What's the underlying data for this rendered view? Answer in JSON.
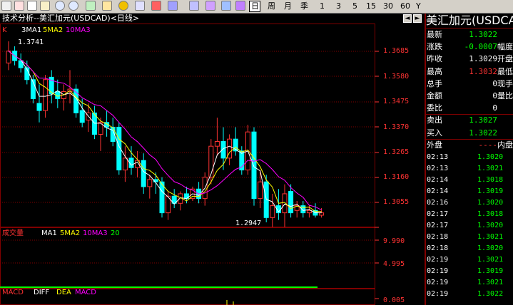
{
  "toolbar": {
    "icons": [
      "chart-icon",
      "chart-icon",
      "f10-icon",
      "zoom-in-icon",
      "zoom-out-icon",
      "refresh-icon",
      "grid-icon",
      "color-icon",
      "pin-icon",
      "box-icon",
      "book-icon"
    ],
    "periods": [
      "日",
      "周",
      "月",
      "季",
      "1",
      "3",
      "5",
      "15",
      "30",
      "60",
      "Y"
    ]
  },
  "header": {
    "title": "技术分析--美汇加元(USDCAD)<日线>",
    "nav_left": "◄",
    "nav_right": "►"
  },
  "main": {
    "legend": {
      "k": "K",
      "ma1": "3MA1",
      "ma2": "5MA2",
      "ma3": "10MA3"
    },
    "high_label": "1.3741",
    "low_label": "1.2947",
    "price_ticks": [
      "1.3685",
      "1.3580",
      "1.3475",
      "1.3370",
      "1.3265",
      "1.3160",
      "1.3055"
    ],
    "volume_legend": {
      "name": "成交量",
      "ma1": "MA1",
      "ma2": "5MA2",
      "ma3": "10MA3",
      "ma3_value": "20"
    },
    "volume_ticks": [
      "9.990",
      "4.995"
    ],
    "macd_legend": {
      "name": "MACD",
      "diff": "DIFF",
      "dea": "DEA",
      "macd": "MACD"
    },
    "macd_ticks": [
      "0.005"
    ]
  },
  "quote": {
    "title": "美汇加元(USDCAD)",
    "rows": [
      {
        "label": "最新",
        "value": "1.3022",
        "value_color": "#00ff00",
        "extra": ""
      },
      {
        "label": "涨跌",
        "value": "-0.0007",
        "value_color": "#00ff00",
        "extra": "幅度"
      },
      {
        "label": "昨收",
        "value": "1.3029",
        "value_color": "#ffffff",
        "extra": "开盘"
      },
      {
        "label": "最高",
        "value": "1.3032",
        "value_color": "#ff3333",
        "extra": "最低"
      },
      {
        "label": "总手",
        "value": "0",
        "value_color": "#ffffff",
        "extra": "现手"
      },
      {
        "label": "金额",
        "value": "0",
        "value_color": "#ffffff",
        "extra": "量比"
      },
      {
        "label": "委比",
        "value": "0",
        "value_color": "#ffffff",
        "extra": ""
      },
      {
        "label": "卖出",
        "value": "1.3027",
        "value_color": "#00ff00",
        "extra": ""
      },
      {
        "label": "买入",
        "value": "1.3022",
        "value_color": "#00ff00",
        "extra": ""
      },
      {
        "label": "外盘",
        "value": "----",
        "value_color": "#ff3333",
        "extra": "内盘"
      }
    ],
    "ticks": [
      {
        "time": "02:13",
        "price": "1.3020"
      },
      {
        "time": "02:13",
        "price": "1.3021"
      },
      {
        "time": "02:14",
        "price": "1.3018"
      },
      {
        "time": "02:14",
        "price": "1.3019"
      },
      {
        "time": "02:16",
        "price": "1.3020"
      },
      {
        "time": "02:17",
        "price": "1.3018"
      },
      {
        "time": "02:17",
        "price": "1.3020"
      },
      {
        "time": "02:18",
        "price": "1.3021"
      },
      {
        "time": "02:18",
        "price": "1.3020"
      },
      {
        "time": "02:19",
        "price": "1.3021"
      },
      {
        "time": "02:19",
        "price": "1.3019"
      },
      {
        "time": "02:19",
        "price": "1.3021"
      },
      {
        "time": "02:19",
        "price": "1.3022"
      }
    ]
  },
  "chart_data": {
    "type": "candlestick",
    "ylim": [
      1.2947,
      1.3741
    ],
    "up_color": "#ff3333",
    "down_color": "#00ffff",
    "candles": [
      [
        1.365,
        1.3741,
        1.362,
        1.37
      ],
      [
        1.37,
        1.372,
        1.364,
        1.366
      ],
      [
        1.366,
        1.369,
        1.361,
        1.363
      ],
      [
        1.363,
        1.366,
        1.356,
        1.358
      ],
      [
        1.358,
        1.36,
        1.348,
        1.35
      ],
      [
        1.348,
        1.356,
        1.34,
        1.345
      ],
      [
        1.345,
        1.36,
        1.342,
        1.358
      ],
      [
        1.359,
        1.362,
        1.348,
        1.352
      ],
      [
        1.353,
        1.358,
        1.346,
        1.35
      ],
      [
        1.35,
        1.356,
        1.345,
        1.353
      ],
      [
        1.353,
        1.362,
        1.348,
        1.354
      ],
      [
        1.354,
        1.356,
        1.342,
        1.344
      ],
      [
        1.345,
        1.35,
        1.338,
        1.34
      ],
      [
        1.341,
        1.348,
        1.336,
        1.344
      ],
      [
        1.344,
        1.347,
        1.333,
        1.335
      ],
      [
        1.335,
        1.342,
        1.328,
        1.34
      ],
      [
        1.34,
        1.345,
        1.334,
        1.338
      ],
      [
        1.338,
        1.342,
        1.33,
        1.332
      ],
      [
        1.338,
        1.34,
        1.318,
        1.32
      ],
      [
        1.32,
        1.33,
        1.315,
        1.325
      ],
      [
        1.325,
        1.33,
        1.318,
        1.321
      ],
      [
        1.321,
        1.328,
        1.317,
        1.324
      ],
      [
        1.324,
        1.327,
        1.31,
        1.313
      ],
      [
        1.313,
        1.318,
        1.308,
        1.316
      ],
      [
        1.316,
        1.319,
        1.31,
        1.315
      ],
      [
        1.315,
        1.317,
        1.3,
        1.302
      ],
      [
        1.302,
        1.311,
        1.299,
        1.309
      ],
      [
        1.309,
        1.312,
        1.304,
        1.306
      ],
      [
        1.306,
        1.311,
        1.303,
        1.31
      ],
      [
        1.31,
        1.313,
        1.306,
        1.308
      ],
      [
        1.308,
        1.313,
        1.307,
        1.312
      ],
      [
        1.312,
        1.315,
        1.306,
        1.308
      ],
      [
        1.308,
        1.319,
        1.305,
        1.317
      ],
      [
        1.317,
        1.333,
        1.314,
        1.33
      ],
      [
        1.33,
        1.342,
        1.326,
        1.332
      ],
      [
        1.332,
        1.338,
        1.32,
        1.325
      ],
      [
        1.325,
        1.335,
        1.322,
        1.333
      ],
      [
        1.333,
        1.338,
        1.326,
        1.328
      ],
      [
        1.328,
        1.33,
        1.318,
        1.32
      ],
      [
        1.32,
        1.339,
        1.318,
        1.336
      ],
      [
        1.336,
        1.338,
        1.305,
        1.308
      ],
      [
        1.308,
        1.32,
        1.304,
        1.315
      ],
      [
        1.315,
        1.318,
        1.298,
        1.3
      ],
      [
        1.3,
        1.31,
        1.296,
        1.305
      ],
      [
        1.305,
        1.312,
        1.299,
        1.302
      ],
      [
        1.302,
        1.314,
        1.296,
        1.31
      ],
      [
        1.311,
        1.314,
        1.3,
        1.302
      ],
      [
        1.303,
        1.307,
        1.3,
        1.305
      ],
      [
        1.305,
        1.307,
        1.3,
        1.302
      ],
      [
        1.302,
        1.305,
        1.3,
        1.303
      ],
      [
        1.303,
        1.306,
        1.3,
        1.301
      ],
      [
        1.301,
        1.304,
        1.3,
        1.302
      ]
    ]
  }
}
